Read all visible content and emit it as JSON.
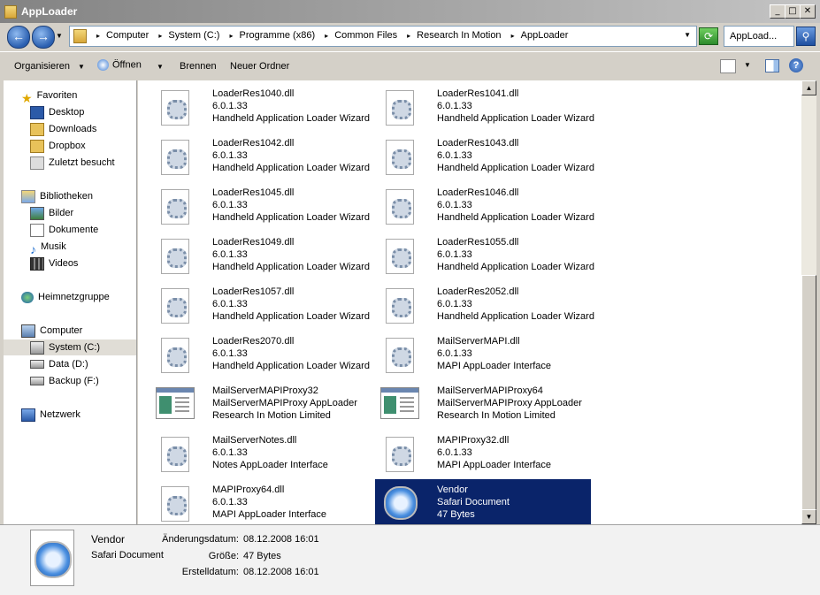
{
  "window": {
    "title": "AppLoader"
  },
  "address": {
    "crumbs": [
      "Computer",
      "System (C:)",
      "Programme (x86)",
      "Common Files",
      "Research In Motion",
      "AppLoader"
    ],
    "search_text": "AppLoad..."
  },
  "toolbar": {
    "organize_label": "Organisieren",
    "open_label": "Öffnen",
    "burn_label": "Brennen",
    "new_folder_label": "Neuer Ordner"
  },
  "nav": {
    "favorites": "Favoriten",
    "desktop": "Desktop",
    "downloads": "Downloads",
    "dropbox": "Dropbox",
    "recent": "Zuletzt besucht",
    "libraries": "Bibliotheken",
    "pictures": "Bilder",
    "documents": "Dokumente",
    "music": "Musik",
    "videos": "Videos",
    "homegroup": "Heimnetzgruppe",
    "computer": "Computer",
    "system_c": "System (C:)",
    "data_d": "Data (D:)",
    "backup_f": "Backup (F:)",
    "network": "Netzwerk"
  },
  "files": [
    {
      "name": "LoaderRes1040.dll",
      "line2": "6.0.1.33",
      "line3": "Handheld Application Loader Wizard",
      "icon": "dll-gear-icon"
    },
    {
      "name": "LoaderRes1041.dll",
      "line2": "6.0.1.33",
      "line3": "Handheld Application Loader Wizard",
      "icon": "dll-gear-icon"
    },
    {
      "name": "LoaderRes1042.dll",
      "line2": "6.0.1.33",
      "line3": "Handheld Application Loader Wizard",
      "icon": "dll-gear-icon"
    },
    {
      "name": "LoaderRes1043.dll",
      "line2": "6.0.1.33",
      "line3": "Handheld Application Loader Wizard",
      "icon": "dll-gear-icon"
    },
    {
      "name": "LoaderRes1045.dll",
      "line2": "6.0.1.33",
      "line3": "Handheld Application Loader Wizard",
      "icon": "dll-gear-icon"
    },
    {
      "name": "LoaderRes1046.dll",
      "line2": "6.0.1.33",
      "line3": "Handheld Application Loader Wizard",
      "icon": "dll-gear-icon"
    },
    {
      "name": "LoaderRes1049.dll",
      "line2": "6.0.1.33",
      "line3": "Handheld Application Loader Wizard",
      "icon": "dll-gear-icon"
    },
    {
      "name": "LoaderRes1055.dll",
      "line2": "6.0.1.33",
      "line3": "Handheld Application Loader Wizard",
      "icon": "dll-gear-icon"
    },
    {
      "name": "LoaderRes1057.dll",
      "line2": "6.0.1.33",
      "line3": "Handheld Application Loader Wizard",
      "icon": "dll-gear-icon"
    },
    {
      "name": "LoaderRes2052.dll",
      "line2": "6.0.1.33",
      "line3": "Handheld Application Loader Wizard",
      "icon": "dll-gear-icon"
    },
    {
      "name": "LoaderRes2070.dll",
      "line2": "6.0.1.33",
      "line3": "Handheld Application Loader Wizard",
      "icon": "dll-gear-icon"
    },
    {
      "name": "MailServerMAPI.dll",
      "line2": "6.0.1.33",
      "line3": "MAPI AppLoader Interface",
      "icon": "dll-gear-icon"
    },
    {
      "name": "MailServerMAPIProxy32",
      "line2": "MailServerMAPIProxy AppLoader",
      "line3": "Research In Motion Limited",
      "icon": "exe-window-icon"
    },
    {
      "name": "MailServerMAPIProxy64",
      "line2": "MailServerMAPIProxy AppLoader",
      "line3": "Research In Motion Limited",
      "icon": "exe-window-icon"
    },
    {
      "name": "MailServerNotes.dll",
      "line2": "6.0.1.33",
      "line3": "Notes AppLoader Interface",
      "icon": "dll-gear-icon"
    },
    {
      "name": "MAPIProxy32.dll",
      "line2": "6.0.1.33",
      "line3": "MAPI AppLoader Interface",
      "icon": "dll-gear-icon"
    },
    {
      "name": "MAPIProxy64.dll",
      "line2": "6.0.1.33",
      "line3": "MAPI AppLoader Interface",
      "icon": "dll-gear-icon"
    },
    {
      "name": "Vendor",
      "line2": "Safari Document",
      "line3": "47 Bytes",
      "icon": "safari-compass-icon",
      "selected": true
    }
  ],
  "details": {
    "name": "Vendor",
    "type": "Safari Document",
    "modified_label": "Änderungsdatum:",
    "modified_value": "08.12.2008 16:01",
    "size_label": "Größe:",
    "size_value": "47 Bytes",
    "created_label": "Erstelldatum:",
    "created_value": "08.12.2008 16:01"
  },
  "colors": {
    "selection": "#0a246a",
    "title_bar": "#a9a9a9"
  }
}
